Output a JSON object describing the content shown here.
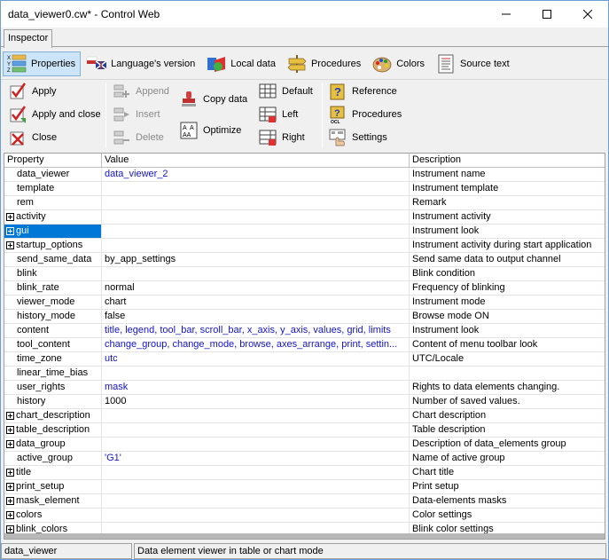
{
  "window": {
    "title": "data_viewer0.cw* - Control Web"
  },
  "tabs": [
    {
      "label": "Inspector"
    }
  ],
  "toolbar_top": [
    {
      "label": "Properties",
      "icon": "properties-icon"
    },
    {
      "label": "Language's version",
      "icon": "flag-icon"
    },
    {
      "label": "Local data",
      "icon": "local-data-icon"
    },
    {
      "label": "Procedures",
      "icon": "procedures-icon"
    },
    {
      "label": "Colors",
      "icon": "palette-icon"
    },
    {
      "label": "Source text",
      "icon": "source-text-icon"
    }
  ],
  "toolbar_actions": {
    "apply": "Apply",
    "apply_close": "Apply and close",
    "close": "Close",
    "append": "Append",
    "insert": "Insert",
    "delete": "Delete",
    "copy_data": "Copy data",
    "optimize": "Optimize",
    "default": "Default",
    "left": "Left",
    "right": "Right",
    "reference": "Reference",
    "procedures": "Procedures",
    "settings": "Settings"
  },
  "grid": {
    "headers": [
      "Property",
      "Value",
      "Description"
    ],
    "rows": [
      {
        "property": "data_viewer",
        "value": "data_viewer_2",
        "description": "Instrument name",
        "expandable": false,
        "vcolor": "blue"
      },
      {
        "property": "template",
        "value": "",
        "description": "Instrument template",
        "expandable": false,
        "vcolor": "blue"
      },
      {
        "property": "rem",
        "value": "",
        "description": "Remark",
        "expandable": false,
        "vcolor": "blue"
      },
      {
        "property": "activity",
        "value": "",
        "description": "Instrument activity",
        "expandable": true,
        "vcolor": "blue"
      },
      {
        "property": "gui",
        "value": "",
        "description": "Instrument look",
        "expandable": true,
        "vcolor": "blue",
        "selected": true
      },
      {
        "property": "startup_options",
        "value": "",
        "description": "Instrument activity during start application",
        "expandable": true,
        "vcolor": "blue"
      },
      {
        "property": "send_same_data",
        "value": "by_app_settings",
        "description": "Send same data to output channel",
        "expandable": false,
        "vcolor": "black"
      },
      {
        "property": "blink",
        "value": "",
        "description": "Blink condition",
        "expandable": false,
        "vcolor": "blue"
      },
      {
        "property": "blink_rate",
        "value": "normal",
        "description": "Frequency of blinking",
        "expandable": false,
        "vcolor": "black"
      },
      {
        "property": "viewer_mode",
        "value": "chart",
        "description": "Instrument mode",
        "expandable": false,
        "vcolor": "black"
      },
      {
        "property": "history_mode",
        "value": "false",
        "description": "Browse mode ON",
        "expandable": false,
        "vcolor": "black"
      },
      {
        "property": "content",
        "value": "title, legend, tool_bar, scroll_bar, x_axis, y_axis, values, grid, limits",
        "description": "Instrument look",
        "expandable": false,
        "vcolor": "blue"
      },
      {
        "property": "tool_content",
        "value": "change_group, change_mode, browse, axes_arrange, print, settin...",
        "description": "Content of menu toolbar look",
        "expandable": false,
        "vcolor": "blue"
      },
      {
        "property": "time_zone",
        "value": "utc",
        "description": "UTC/Locale",
        "expandable": false,
        "vcolor": "blue"
      },
      {
        "property": "linear_time_bias",
        "value": "",
        "description": "",
        "expandable": false,
        "vcolor": "blue"
      },
      {
        "property": "user_rights",
        "value": "mask",
        "description": "Rights to data elements changing.",
        "expandable": false,
        "vcolor": "blue"
      },
      {
        "property": "history",
        "value": "1000",
        "description": "Number of saved values.",
        "expandable": false,
        "vcolor": "black"
      },
      {
        "property": "chart_description",
        "value": "",
        "description": "Chart description",
        "expandable": true,
        "vcolor": "blue"
      },
      {
        "property": "table_description",
        "value": "",
        "description": "Table description",
        "expandable": true,
        "vcolor": "blue"
      },
      {
        "property": "data_group",
        "value": "",
        "description": "Description of data_elements group",
        "expandable": true,
        "vcolor": "blue"
      },
      {
        "property": "active_group",
        "value": "'G1'",
        "description": "Name of active group",
        "expandable": false,
        "vcolor": "blue"
      },
      {
        "property": "title",
        "value": "",
        "description": "Chart title",
        "expandable": true,
        "vcolor": "blue"
      },
      {
        "property": "print_setup",
        "value": "",
        "description": "Print setup",
        "expandable": true,
        "vcolor": "blue"
      },
      {
        "property": "mask_element",
        "value": "",
        "description": "Data-elements masks",
        "expandable": true,
        "vcolor": "blue"
      },
      {
        "property": "colors",
        "value": "",
        "description": "Color settings",
        "expandable": true,
        "vcolor": "blue"
      },
      {
        "property": "blink_colors",
        "value": "",
        "description": "Blink color settings",
        "expandable": true,
        "vcolor": "blue"
      }
    ]
  },
  "statusbar": {
    "left": "data_viewer",
    "right": "Data element viewer in table or chart mode"
  },
  "colors": {
    "selection": "#0078d7",
    "value_text": "#1414c8",
    "accent": "#cce4f7"
  }
}
